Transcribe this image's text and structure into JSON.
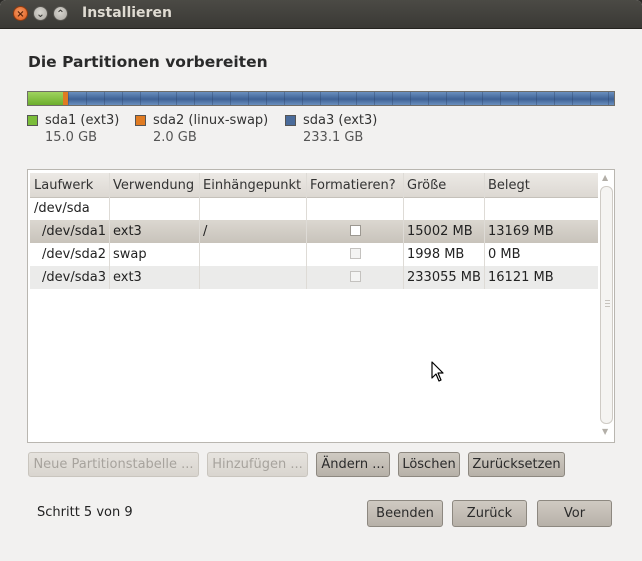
{
  "window": {
    "title": "Installieren"
  },
  "page": {
    "heading": "Die Partitionen vorbereiten"
  },
  "partitions_bar": {
    "segments": [
      {
        "name": "sda1",
        "fraction": 0.06,
        "color": "#7bbd3a"
      },
      {
        "name": "sda2",
        "fraction": 0.008,
        "color": "#e07b22"
      },
      {
        "name": "sda3",
        "fraction": 0.932,
        "color": "#4a6b9a"
      }
    ]
  },
  "legend": [
    {
      "label": "sda1 (ext3)",
      "size": "15.0 GB",
      "color": "#7bbd3a"
    },
    {
      "label": "sda2 (linux-swap)",
      "size": "2.0 GB",
      "color": "#e07b22"
    },
    {
      "label": "sda3 (ext3)",
      "size": "233.1 GB",
      "color": "#4a6b9a"
    }
  ],
  "table": {
    "columns": [
      "Laufwerk",
      "Verwendung",
      "Einhängepunkt",
      "Formatieren?",
      "Größe",
      "Belegt"
    ],
    "device_row": {
      "drive": "/dev/sda"
    },
    "rows": [
      {
        "drive": "/dev/sda1",
        "type": "ext3",
        "mount": "/",
        "format": false,
        "size": "15002 MB",
        "used": "13169 MB",
        "selected": true
      },
      {
        "drive": "/dev/sda2",
        "type": "swap",
        "mount": "",
        "format": false,
        "size": "1998 MB",
        "used": "0 MB",
        "selected": false
      },
      {
        "drive": "/dev/sda3",
        "type": "ext3",
        "mount": "",
        "format": false,
        "size": "233055 MB",
        "used": "16121 MB",
        "selected": false
      }
    ]
  },
  "actions": {
    "new_table": "Neue Partitionstabelle ...",
    "add": "Hinzufügen ...",
    "change": "Ändern ...",
    "delete": "Löschen",
    "reset": "Zurücksetzen"
  },
  "footer": {
    "step": "Schritt 5 von 9",
    "quit": "Beenden",
    "back": "Zurück",
    "forward": "Vor"
  },
  "icons": {
    "close": "x-icon",
    "minimize": "chevron-down-icon",
    "maximize": "chevron-up-icon"
  }
}
